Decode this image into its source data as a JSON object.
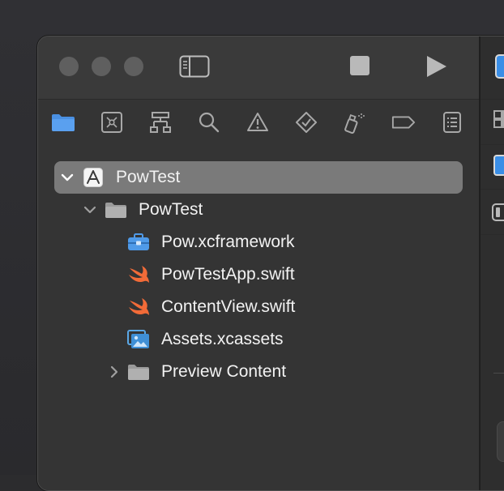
{
  "navigator": {
    "tabs": [
      {
        "icon": "folder-icon",
        "active": true
      },
      {
        "icon": "source-control-icon"
      },
      {
        "icon": "symbol-hierarchy-icon"
      },
      {
        "icon": "search-icon"
      },
      {
        "icon": "warning-icon"
      },
      {
        "icon": "test-diamond-icon"
      },
      {
        "icon": "debug-spray-icon"
      },
      {
        "icon": "breakpoint-tag-icon"
      },
      {
        "icon": "report-list-icon"
      }
    ],
    "tree": {
      "project": "PowTest",
      "group": "PowTest",
      "files": [
        {
          "name": "Pow.xcframework",
          "icon": "toolbox-icon"
        },
        {
          "name": "PowTestApp.swift",
          "icon": "swift-icon"
        },
        {
          "name": "ContentView.swift",
          "icon": "swift-icon"
        },
        {
          "name": "Assets.xcassets",
          "icon": "asset-catalog-icon"
        }
      ],
      "collapsed_group": "Preview Content"
    }
  },
  "colors": {
    "accent": "#3a8ee6",
    "swift": "#f26b38",
    "selection": "#7a7a7a"
  }
}
